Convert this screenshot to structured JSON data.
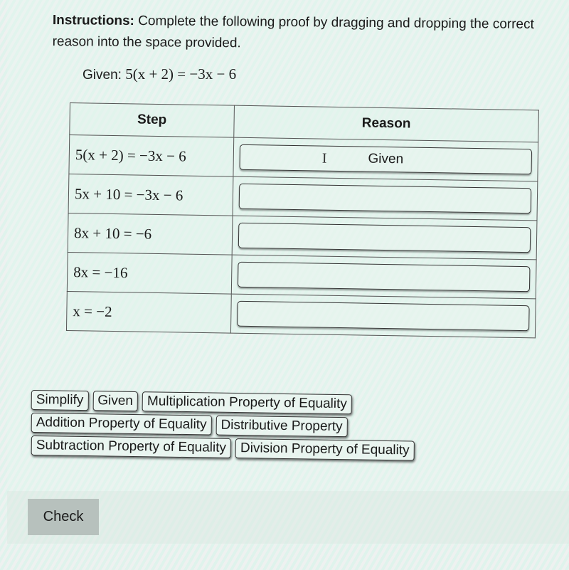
{
  "instructions": {
    "label": "Instructions:",
    "text": " Complete the following proof by dragging and dropping the correct reason into the space provided."
  },
  "given": {
    "label": "Given: ",
    "equation": "5(x + 2) = −3x − 6"
  },
  "table": {
    "headers": {
      "step": "Step",
      "reason": "Reason"
    },
    "rows": [
      {
        "step": "5(x + 2) = −3x − 6",
        "reason": "Given"
      },
      {
        "step": "5x + 10 = −3x − 6",
        "reason": ""
      },
      {
        "step": "8x + 10 = −6",
        "reason": ""
      },
      {
        "step": "8x = −16",
        "reason": ""
      },
      {
        "step": "x = −2",
        "reason": ""
      }
    ]
  },
  "cursor": {
    "icon": "text-cursor-icon",
    "glyph": "I"
  },
  "reason_bank": [
    [
      "Simplify",
      "Given",
      "Multiplication Property of Equality"
    ],
    [
      "Addition Property of Equality",
      "Distributive Property"
    ],
    [
      "Subtraction Property of Equality",
      "Division Property of Equality"
    ]
  ],
  "check_button": {
    "label": "Check"
  }
}
